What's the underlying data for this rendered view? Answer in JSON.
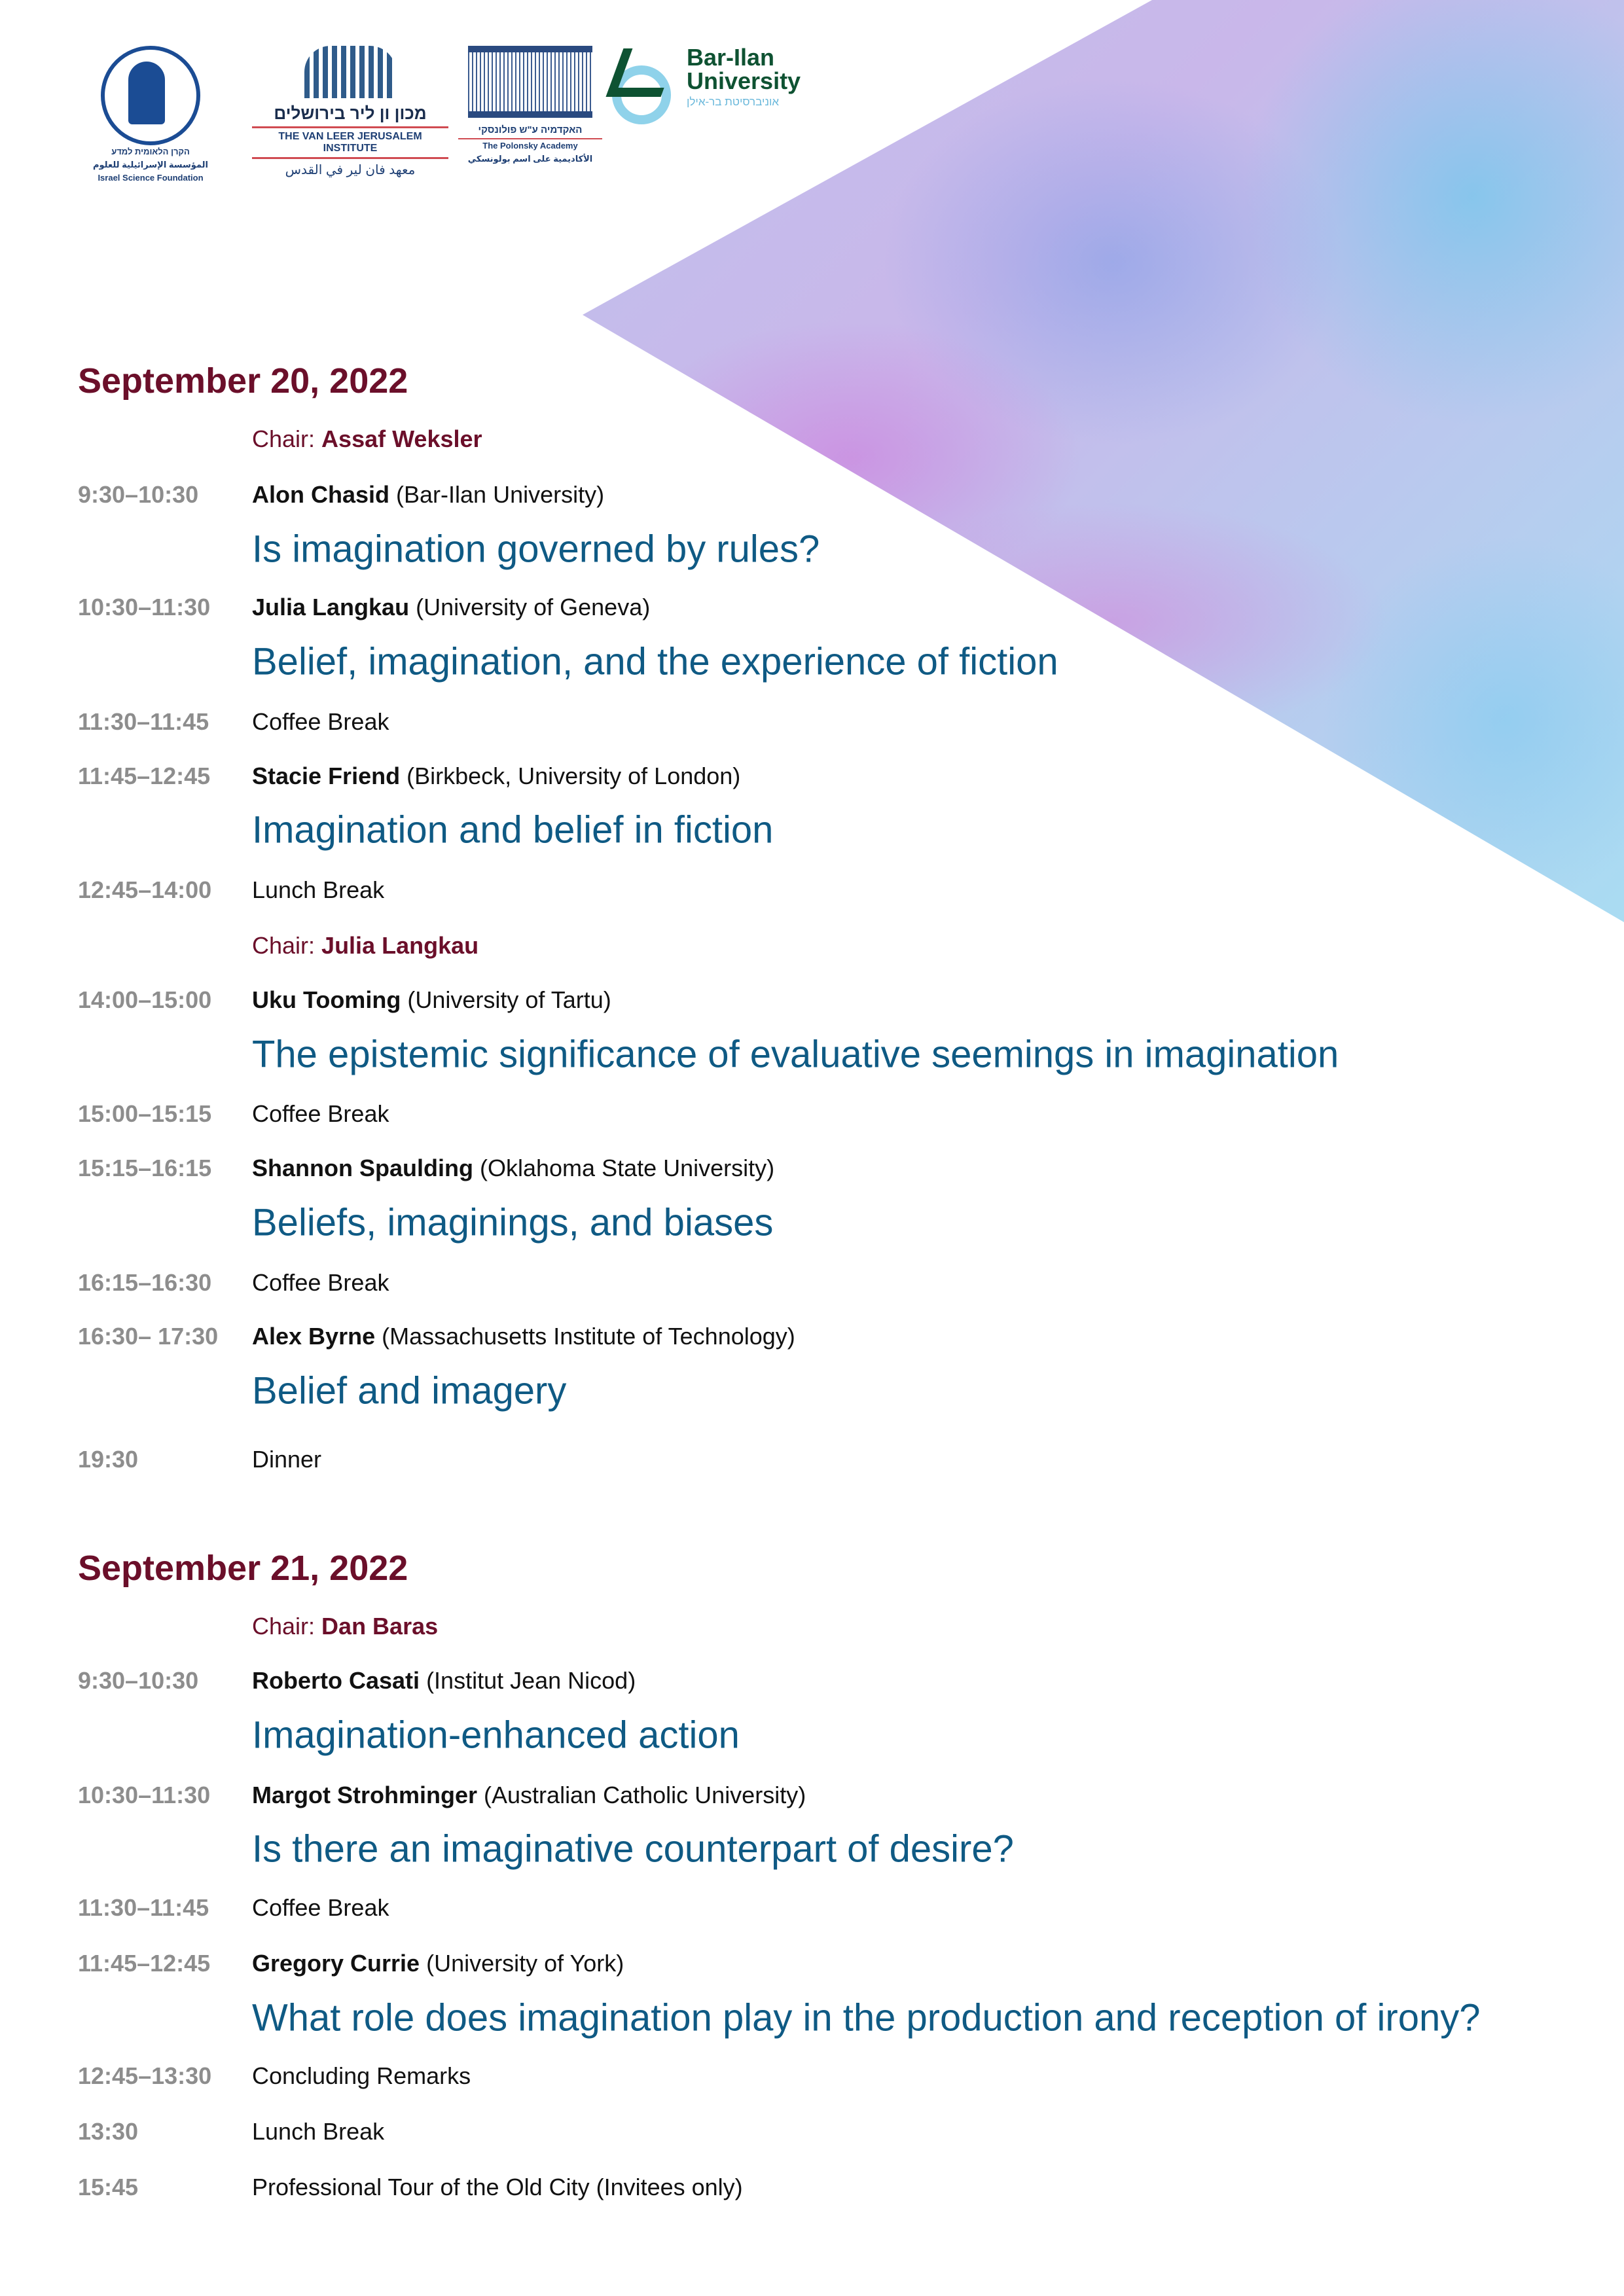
{
  "logos": {
    "isf": {
      "hebrew": "הקרן הלאומית למדע",
      "arabic": "المؤسسة الإسرائيلية للعلوم",
      "english": "Israel Science Foundation"
    },
    "van_leer": {
      "hebrew": "מכון ון ליר בירושלים",
      "english": "THE VAN LEER JERUSALEM INSTITUTE",
      "arabic": "معهد فان لير في القدس"
    },
    "polonsky": {
      "hebrew": "האקדמיה ע\"ש פולונסקי",
      "english": "The Polonsky Academy",
      "arabic": "الأكاديمية على اسم بولونسكي"
    },
    "bar_ilan": {
      "line1": "Bar-Ilan",
      "line2": "University",
      "hebrew": "אוניברסיטת בר-אילן"
    }
  },
  "days": [
    {
      "date": "September 20, 2022",
      "items": [
        {
          "type": "chair",
          "label": "Chair:",
          "name": "Assaf Weksler"
        },
        {
          "type": "talk",
          "time": "9:30–10:30",
          "speaker": "Alon Chasid",
          "affiliation": "(Bar-Ilan University)",
          "title": "Is imagination governed by rules?"
        },
        {
          "type": "talk",
          "time": "10:30–11:30",
          "speaker": "Julia Langkau",
          "affiliation": "(University of Geneva)",
          "title": "Belief, imagination, and the experience of fiction"
        },
        {
          "type": "break",
          "time": "11:30–11:45",
          "label": "Coffee Break"
        },
        {
          "type": "talk",
          "time": "11:45–12:45",
          "speaker": "Stacie Friend",
          "affiliation": "(Birkbeck, University of London)",
          "title": "Imagination and belief in fiction"
        },
        {
          "type": "break",
          "time": "12:45–14:00",
          "label": "Lunch Break"
        },
        {
          "type": "chair",
          "label": "Chair:",
          "name": "Julia Langkau"
        },
        {
          "type": "talk",
          "time": "14:00–15:00",
          "speaker": "Uku Tooming",
          "affiliation": "(University of Tartu)",
          "title": "The epistemic significance of evaluative seemings in imagination"
        },
        {
          "type": "break",
          "time": "15:00–15:15",
          "label": "Coffee Break"
        },
        {
          "type": "talk",
          "time": "15:15–16:15",
          "speaker": "Shannon Spaulding",
          "affiliation": "(Oklahoma State University)",
          "title": "Beliefs, imaginings, and biases"
        },
        {
          "type": "break",
          "time": "16:15–16:30",
          "label": "Coffee Break"
        },
        {
          "type": "talk",
          "time": "16:30– 17:30",
          "speaker": "Alex Byrne",
          "affiliation": "(Massachusetts Institute of Technology)",
          "title": "Belief and imagery"
        },
        {
          "type": "break",
          "time": "19:30",
          "label": "Dinner"
        }
      ]
    },
    {
      "date": "September 21, 2022",
      "items": [
        {
          "type": "chair",
          "label": "Chair:",
          "name": "Dan Baras"
        },
        {
          "type": "talk",
          "time": "9:30–10:30",
          "speaker": "Roberto Casati",
          "affiliation": "(Institut Jean Nicod)",
          "title": "Imagination-enhanced action"
        },
        {
          "type": "talk",
          "time": "10:30–11:30",
          "speaker": "Margot Strohminger",
          "affiliation": "(Australian Catholic University)",
          "title": "Is there an imaginative counterpart of desire?"
        },
        {
          "type": "break",
          "time": "11:30–11:45",
          "label": "Coffee Break"
        },
        {
          "type": "talk",
          "time": "11:45–12:45",
          "speaker": "Gregory Currie",
          "affiliation": "(University of York)",
          "title": "What role does imagination play in the production and reception of irony?"
        },
        {
          "type": "break",
          "time": "12:45–13:30",
          "label": "Concluding Remarks"
        },
        {
          "type": "break",
          "time": "13:30",
          "label": "Lunch Break"
        },
        {
          "type": "break",
          "time": "15:45",
          "label": "Professional Tour of the Old City (Invitees only)"
        }
      ]
    }
  ]
}
